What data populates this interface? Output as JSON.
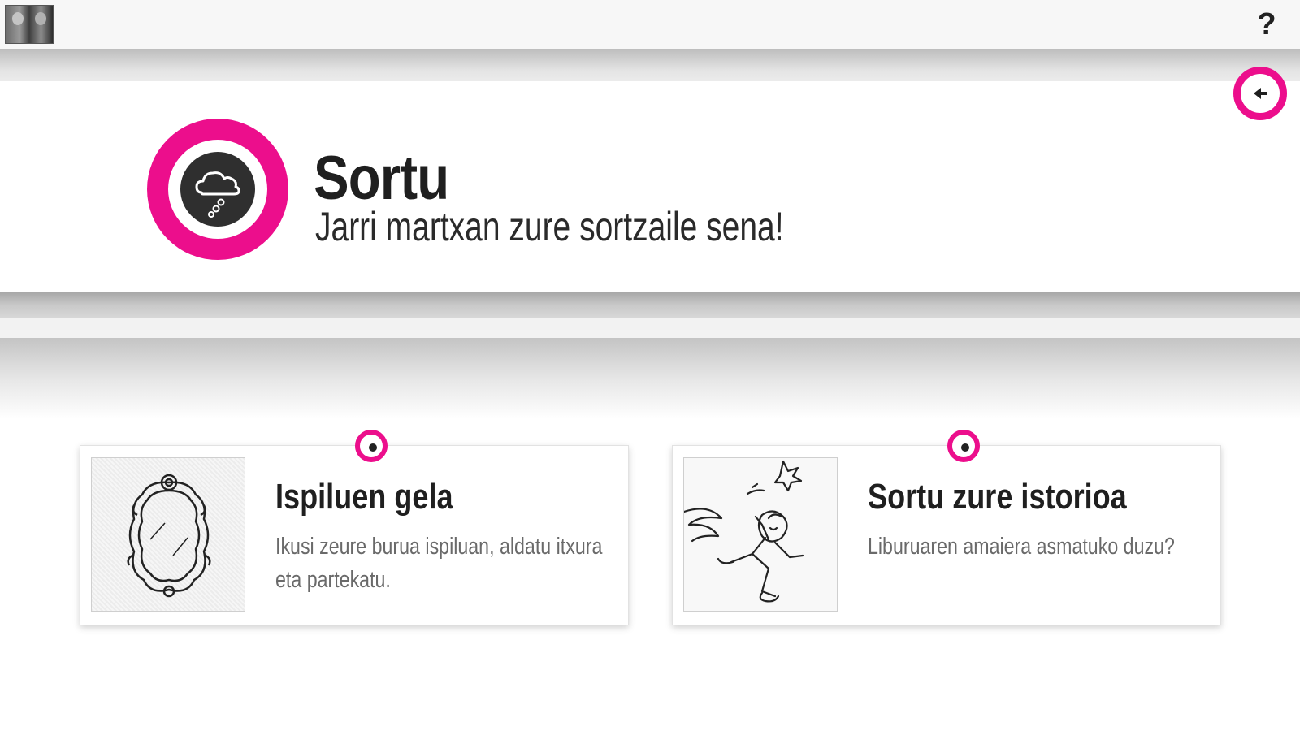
{
  "topbar": {
    "avatar_alt": "",
    "help_label": "?"
  },
  "header": {
    "title": "Sortu",
    "subtitle": "Jarri martxan zure sortzaile sena!",
    "accent_color": "#ec0e8c",
    "logo_icon": "cloud-icon",
    "back_icon": "arrow-left-icon"
  },
  "cards": [
    {
      "title": "Ispiluen gela",
      "description": "Ikusi zeure burua ispiluan, aldatu itxura eta partekatu.",
      "thumbnail_icon": "ornate-mirror-icon"
    },
    {
      "title": "Sortu zure istorioa",
      "description": "Liburuaren amaiera asmatuko duzu?",
      "thumbnail_icon": "running-character-icon"
    }
  ]
}
